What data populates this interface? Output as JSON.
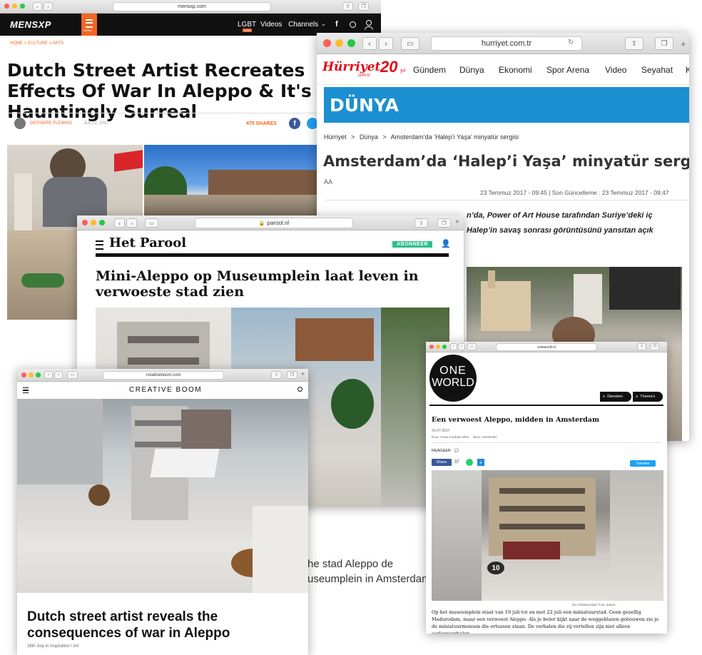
{
  "mensxp": {
    "url": "mensxp.com",
    "logo": "MENSXP",
    "menu_label": "MENU",
    "nav": [
      "LGBT",
      "Videos",
      "Channels"
    ],
    "new_badge": "NEW",
    "breadcrumb": "HOME > CULTURE > ARTS",
    "headline": "Dutch Street Artist Recreates Effects Of War In Aleppo & It's Hauntingly Surreal",
    "author": "DESSIDRE FLEMING",
    "date": "JUL 22, 2017",
    "shares": "475 SHARES"
  },
  "hurriyet": {
    "url": "hurriyet.com.tr",
    "logo": "Hürriyet",
    "logo_sub": "com.tr",
    "anniv": "20",
    "anniv_suffix": "yıl",
    "nav": [
      "Gündem",
      "Dünya",
      "Ekonomi",
      "Spor Arena",
      "Video",
      "Seyahat",
      "K"
    ],
    "section": "DÜNYA",
    "breadcrumb": [
      "Hürriyet",
      ">",
      "Dünya",
      ">",
      "Amsterdam’da ‘Halep’i Yaşa’ minyatür sergisi"
    ],
    "headline": "Amsterdam’da ‘Halep’i Yaşa’ minyatür sergisi",
    "source": "AA",
    "dates": "23 Temmuz 2017 - 09:45 | Son Güncelleme : 23 Temmuz 2017 - 09:47",
    "lead_line1": "n’da, Power of Art House tarafından Suriye’deki iç",
    "lead_line2": "Halep’in savaş sonrası görüntüsünü yansıtan açık"
  },
  "parool": {
    "url": "parool.nl",
    "logo": "Het Parool",
    "subscribe": "ABONNEER",
    "headline": "Mini-Aleppo op Museumplein laat leven in verwoeste stad zien",
    "caption_line1": "he stad Aleppo de",
    "caption_line2": "useumplein in Amsterdam."
  },
  "creativeboom": {
    "url": "creativeboom.com",
    "logo": "CREATIVE BOOM",
    "headline": "Dutch street artist reveals the consequences of war in Aleppo",
    "meta": "26th July in Inspiration / Art"
  },
  "oneworld": {
    "url": "oneworld.nl",
    "logo_line1": "ONE",
    "logo_line2": "WORLD",
    "menu": [
      "Diensten",
      "Thema's"
    ],
    "headline": "Een verwoest Aleppo, midden in Amsterdam",
    "date": "20-07-2017",
    "byline": "Door: Fiona Korthals Altes     Bron: OneWorld",
    "react": "REAGEER",
    "fb_share": "Share",
    "fb_count": "37",
    "tweet": "Tweeten",
    "sign_number": "10",
    "img_caption": "De miniatuurstad. Foto: auteur.",
    "body": "Op het museumplein staat van 19 juli tot en met 22 juli een miniatuurstad. Geen gezellig Madurodam, maar een verwoest Aleppo. Als je beter kijkt naar de weggeblazen gebouwen zie je de miniatuurmensen die ertussen staan. De verhalen die zij vertellen zijn niet alleen oorlogsverhalen,"
  },
  "colors": {
    "mensxp_orange": "#f26522",
    "hurriyet_red": "#e30613",
    "dunya_blue": "#1b8fd0",
    "parool_green": "#2cbf8f",
    "facebook_blue": "#3b5998",
    "twitter_blue": "#1da1f2",
    "whatsapp_green": "#25d366"
  }
}
